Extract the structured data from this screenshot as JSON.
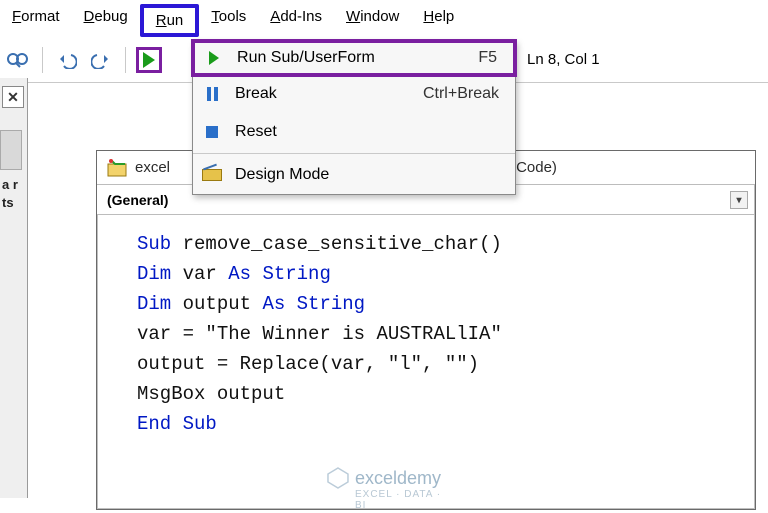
{
  "menubar": {
    "format": "Format",
    "debug": "Debug",
    "run": "Run",
    "tools": "Tools",
    "addins": "Add-Ins",
    "window": "Window",
    "help": "Help"
  },
  "toolbar": {
    "status": "Ln 8, Col 1"
  },
  "run_menu": {
    "run_sub": {
      "label": "Run Sub/UserForm",
      "shortcut": "F5"
    },
    "break": {
      "label": "Break",
      "shortcut": "Ctrl+Break"
    },
    "reset": {
      "label": "Reset",
      "shortcut": ""
    },
    "design": {
      "label": "Design Mode",
      "shortcut": ""
    }
  },
  "left_panel": {
    "line1": "a r",
    "line2": "ts"
  },
  "mdi": {
    "title_prefix": "excel",
    "title_suffix": ".xlsx - Module1 (Code)",
    "combo_left": "(General)"
  },
  "code": {
    "l1a": "Sub",
    "l1b": " remove_case_sensitive_char()",
    "l2a": "Dim",
    "l2b": " var ",
    "l2c": "As String",
    "l3a": "Dim",
    "l3b": " output ",
    "l3c": "As String",
    "l4": "var = \"The Winner is AUSTRALlIA\"",
    "l5": "output = Replace(var, \"l\", \"\")",
    "l6": "MsgBox output",
    "l7": "End Sub"
  },
  "watermark": {
    "brand": "exceldemy",
    "tag": "EXCEL · DATA · BI"
  }
}
